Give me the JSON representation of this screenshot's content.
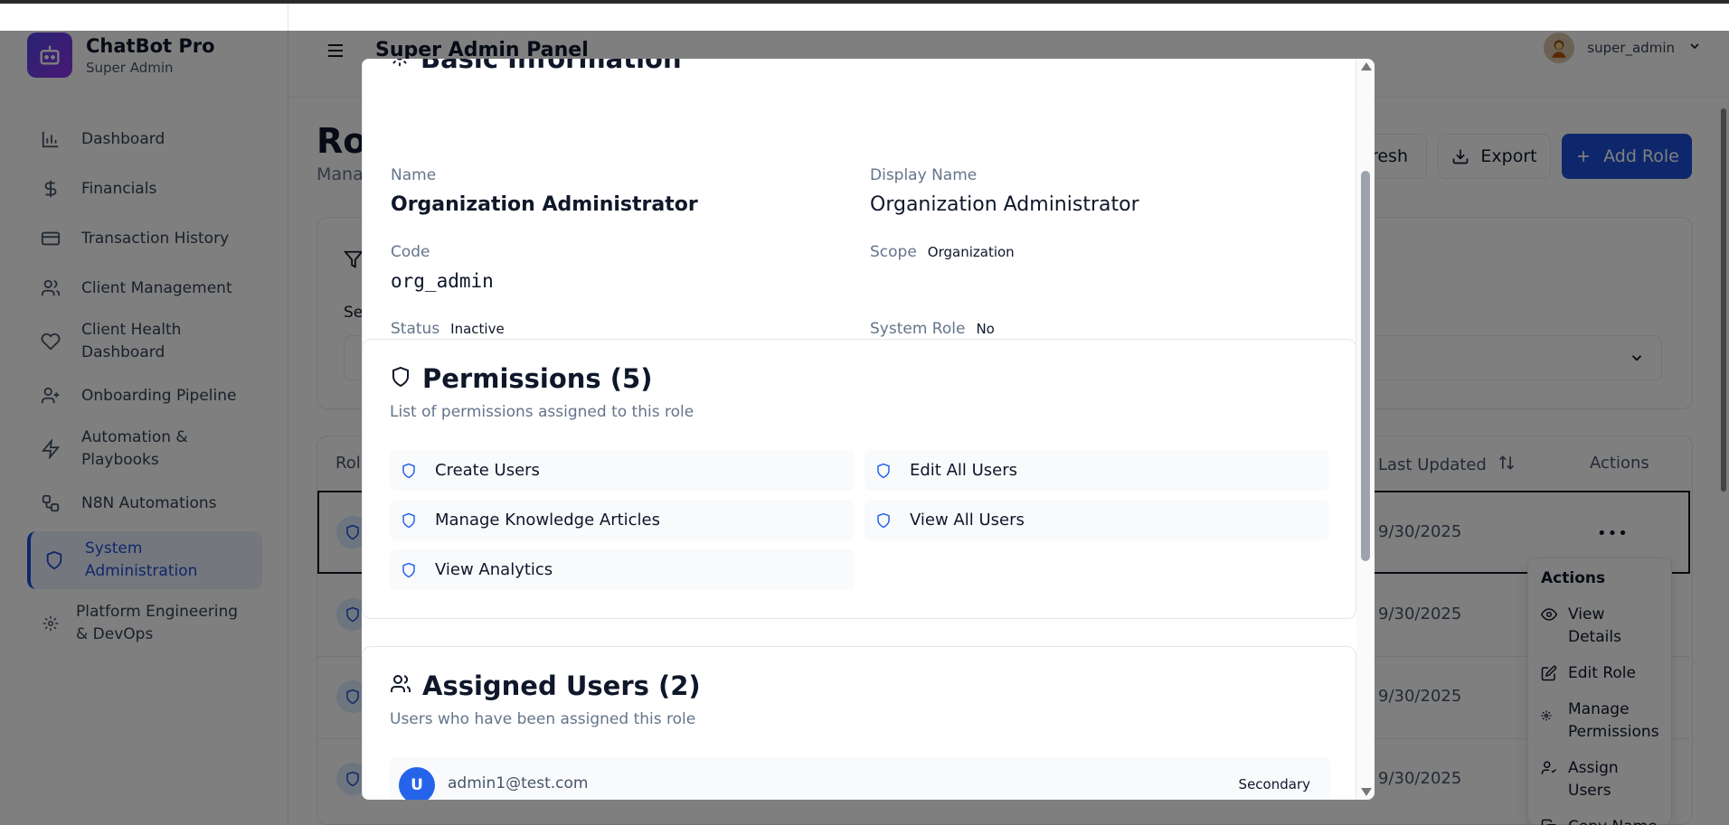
{
  "app": {
    "name": "ChatBot Pro",
    "subtitle": "Super Admin"
  },
  "sidebar": {
    "items": [
      {
        "label": "Dashboard",
        "icon": "bar-chart-icon"
      },
      {
        "label": "Financials",
        "icon": "dollar-icon"
      },
      {
        "label": "Transaction History",
        "icon": "credit-card-icon"
      },
      {
        "label": "Client Management",
        "icon": "users-icon"
      },
      {
        "label": "Client Health Dashboard",
        "icon": "heart-icon"
      },
      {
        "label": "Onboarding Pipeline",
        "icon": "user-plus-icon"
      },
      {
        "label": "Automation & Playbooks",
        "icon": "bolt-icon"
      },
      {
        "label": "N8N Automations",
        "icon": "workflow-icon"
      },
      {
        "label": "System Administration",
        "icon": "shield-icon",
        "active": true
      },
      {
        "label": "Platform Engineering & DevOps",
        "icon": "gear-icon"
      }
    ]
  },
  "header": {
    "title": "Super Admin Panel",
    "user_name": "super_admin"
  },
  "page": {
    "title_partial": "Rol",
    "subtitle_partial": "Mana",
    "refresh_partial": "fresh",
    "export_label": "Export",
    "add_role_label": "Add Role",
    "filter_label_partial": "Se"
  },
  "table": {
    "header_role_partial": "Rol",
    "header_last_updated": "Last Updated",
    "header_actions": "Actions",
    "rows": [
      {
        "last_updated": "9/30/2025"
      },
      {
        "last_updated": "9/30/2025"
      },
      {
        "last_updated": "9/30/2025"
      },
      {
        "last_updated": "9/30/2025"
      }
    ],
    "row_menu_glyph": "•••"
  },
  "actions_menu": {
    "title": "Actions",
    "items": [
      {
        "label": "View Details",
        "icon": "eye-icon"
      },
      {
        "label": "Edit Role",
        "icon": "edit-icon"
      },
      {
        "label": "Manage Permissions",
        "icon": "gear-icon"
      },
      {
        "label": "Assign Users",
        "icon": "user-check-icon"
      },
      {
        "label": "Copy Name",
        "icon": "copy-icon"
      }
    ]
  },
  "modal": {
    "basic_info": {
      "title": "Basic Information",
      "name_label": "Name",
      "name_value": "Organization Administrator",
      "display_name_label": "Display Name",
      "display_name_value": "Organization Administrator",
      "code_label": "Code",
      "code_value": "org_admin",
      "scope_label": "Scope",
      "scope_value": "Organization",
      "status_label": "Status",
      "status_value": "Inactive",
      "system_role_label": "System Role",
      "system_role_value": "No"
    },
    "permissions": {
      "title": "Permissions (5)",
      "description": "List of permissions assigned to this role",
      "items": [
        "Create Users",
        "Edit All Users",
        "Manage Knowledge Articles",
        "View All Users",
        "View Analytics"
      ]
    },
    "assigned_users": {
      "title": "Assigned Users (2)",
      "description": "Users who have been assigned this role",
      "users": [
        {
          "initial": "U",
          "email": "admin1@test.com",
          "type": "Secondary"
        }
      ]
    }
  },
  "colors": {
    "primary": "#1d4ed8",
    "brand_gradient_start": "#4f46e5",
    "brand_gradient_end": "#9333ea",
    "overlay": "rgba(0,0,0,0.5)"
  }
}
